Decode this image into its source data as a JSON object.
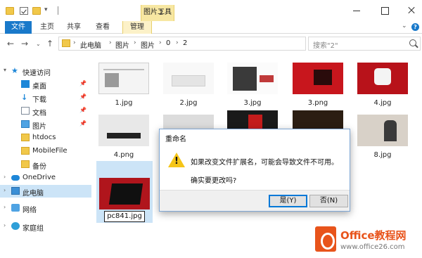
{
  "window": {
    "context_tab": "图片工具",
    "title": "2"
  },
  "ribbon": {
    "tabs": [
      "文件",
      "主页",
      "共享",
      "查看",
      "管理"
    ]
  },
  "address": {
    "crumbs": [
      "此电脑",
      "图片",
      "图片",
      "0",
      "2"
    ]
  },
  "search": {
    "placeholder": "搜索\"2\""
  },
  "sidebar": {
    "items": [
      {
        "label": "快速访问",
        "icon": "star-icon"
      },
      {
        "label": "桌面",
        "icon": "desktop-icon",
        "pinned": true
      },
      {
        "label": "下载",
        "icon": "download-icon",
        "pinned": true
      },
      {
        "label": "文档",
        "icon": "document-icon",
        "pinned": true
      },
      {
        "label": "图片",
        "icon": "pictures-icon",
        "pinned": true
      },
      {
        "label": "htdocs",
        "icon": "folder-icon"
      },
      {
        "label": "MobileFile",
        "icon": "folder-icon"
      },
      {
        "label": "备份",
        "icon": "folder-icon"
      },
      {
        "label": "OneDrive",
        "icon": "cloud-icon"
      },
      {
        "label": "此电脑",
        "icon": "computer-icon",
        "selected": true
      },
      {
        "label": "网络",
        "icon": "network-icon"
      },
      {
        "label": "家庭组",
        "icon": "homegroup-icon"
      }
    ]
  },
  "files": [
    {
      "name": "1.jpg"
    },
    {
      "name": "2.jpg"
    },
    {
      "name": "3.jpg"
    },
    {
      "name": "3.png"
    },
    {
      "name": "4.jpg"
    },
    {
      "name": "4.png"
    },
    {
      "name": "8.jpg"
    },
    {
      "name": "pc841.jpg",
      "renaming": true
    }
  ],
  "dialog": {
    "title": "重命名",
    "message": "如果改变文件扩展名，可能会导致文件不可用。",
    "question": "确实要更改吗?",
    "yes_label": "是(Y)",
    "no_label": "否(N)"
  },
  "watermark": {
    "brand": "Office教程网",
    "url": "www.office26.com"
  },
  "colors": {
    "accent": "#1979ca",
    "tool_tab": "#f7e7a2",
    "selection": "#cce4f7",
    "warning": "#f5c518",
    "watermark": "#e8541b"
  }
}
